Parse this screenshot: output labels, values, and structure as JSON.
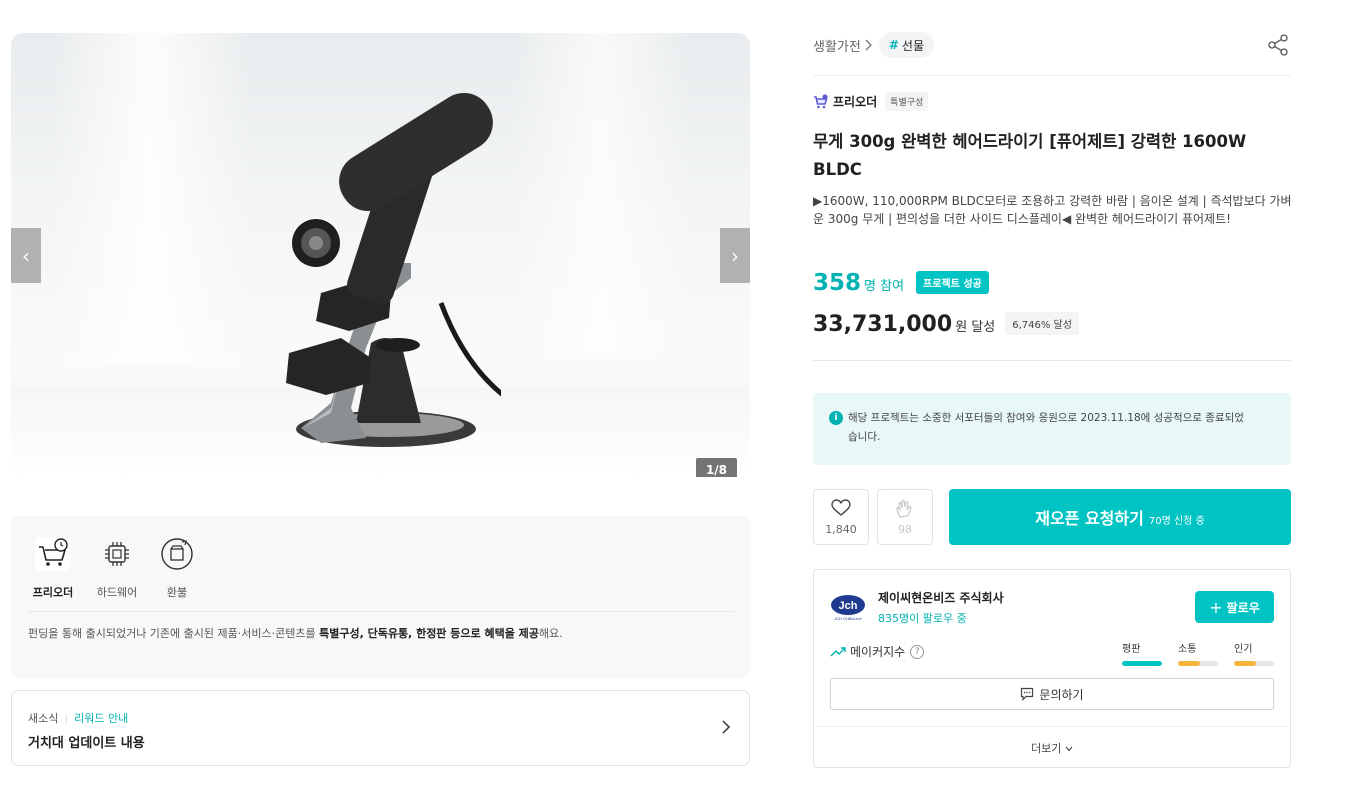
{
  "gallery": {
    "counter": "1/8",
    "prev_arrow": "‹",
    "next_arrow": "›"
  },
  "badges": {
    "items": [
      {
        "label": "프리오더",
        "icon": "cart-clock-icon",
        "active": true
      },
      {
        "label": "하드웨어",
        "icon": "chip-icon",
        "active": false
      },
      {
        "label": "환불",
        "icon": "refund-icon",
        "active": false
      }
    ],
    "desc_pre": "펀딩을 통해 출시되었거나 기존에 출시된 제품·서비스·콘텐츠를 ",
    "desc_bold1": "특별구성, 단독유통, 한정판 등으로 혜택을 제공",
    "desc_post": "해요."
  },
  "update": {
    "tag1": "새소식",
    "tag2": "리워드 안내",
    "title": "거치대 업데이트 내용"
  },
  "breadcrumb": {
    "category": "생활가전",
    "tag_hash": "#",
    "tag": "선물"
  },
  "preorder": {
    "name": "프리오더",
    "chip": "특별구성"
  },
  "product": {
    "title": "무게 300g 완벽한 헤어드라이기 [퓨어제트] 강력한 1600W BLDC",
    "subtitle": "▶1600W, 110,000RPM BLDC모터로 조용하고 강력한 바람 | 음이온 설계 | 즉석밥보다 가벼운 300g 무게 | 편의성을 더한 사이드 디스플레이◀ 완벽한 헤어드라이기 퓨어제트!"
  },
  "stats": {
    "participants": "358",
    "participants_unit": "명 참여",
    "success_badge": "프로젝트 성공",
    "amount": "33,731,000",
    "amount_unit": "원 달성",
    "rate": "6,746% 달성"
  },
  "notice": {
    "icon": "i",
    "text": "해당 프로젝트는 소중한 서포터들의 참여와 응원으로 2023.11.18에 성공적으로 종료되었습니다."
  },
  "actions": {
    "like_count": "1,840",
    "clap_count": "98",
    "cta_main": "재오픈 요청하기",
    "cta_sub": "70명 신청 중"
  },
  "maker": {
    "logo_text": "Jch",
    "logo_sub": "JCH OnBizLine",
    "name": "제이씨현온비즈 주식회사",
    "followers": "835명이 팔로우 중",
    "follow_label": "팔로우",
    "index_label": "메이커지수",
    "index_help": "?",
    "meters": [
      {
        "label": "평판",
        "level": 1.0,
        "color": "#00c4c4"
      },
      {
        "label": "소통",
        "level": 0.55,
        "color": "#f5b43b"
      },
      {
        "label": "인기",
        "level": 0.55,
        "color": "#f5b43b"
      }
    ],
    "inquiry_label": "문의하기",
    "more_label": "더보기"
  },
  "colors": {
    "accent": "#00c4c4",
    "accent_text": "#00b2b2"
  }
}
